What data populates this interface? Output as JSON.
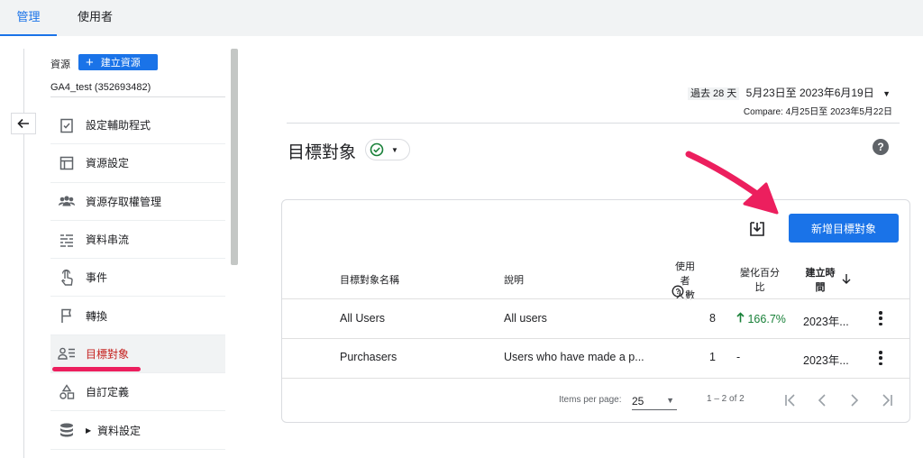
{
  "top_tabs": [
    {
      "label": "管理",
      "active": true
    },
    {
      "label": "使用者",
      "active": false
    }
  ],
  "sidebar": {
    "property_label": "資源",
    "create_button": "建立資源",
    "property_name": "GA4_test (352693482)",
    "items": [
      {
        "label": "設定輔助程式",
        "icon": "clipboard-check-icon"
      },
      {
        "label": "資源設定",
        "icon": "layout-icon"
      },
      {
        "label": "資源存取權管理",
        "icon": "people-icon"
      },
      {
        "label": "資料串流",
        "icon": "streams-icon"
      },
      {
        "label": "事件",
        "icon": "touch-icon"
      },
      {
        "label": "轉換",
        "icon": "flag-icon"
      },
      {
        "label": "目標對象",
        "icon": "audience-icon",
        "active": true
      },
      {
        "label": "自訂定義",
        "icon": "shapes-icon"
      },
      {
        "label": "資料設定",
        "icon": "database-icon",
        "expandable": true
      }
    ]
  },
  "date_range": {
    "period": "過去 28 天",
    "dates": "5月23日至 2023年6月19日",
    "compare": "Compare: 4月25日至 2023年5月22日"
  },
  "page": {
    "title": "目標對象",
    "new_button": "新增目標對象"
  },
  "table": {
    "headers": {
      "name": "目標對象名稱",
      "description": "說明",
      "users_line1": "使用者",
      "users_line2": "人數",
      "change_line1": "變化百分",
      "change_line2": "比",
      "created_line1": "建立時",
      "created_line2": "間"
    },
    "rows": [
      {
        "name": "All Users",
        "description": "All users",
        "users": "8",
        "change": "166.7%",
        "change_up": true,
        "created": "2023年..."
      },
      {
        "name": "Purchasers",
        "description": "Users who have made a p...",
        "users": "1",
        "change": "-",
        "change_up": false,
        "created": "2023年..."
      }
    ]
  },
  "pagination": {
    "items_per_page_label": "Items per page:",
    "items_per_page": "25",
    "range": "1 – 2 of 2"
  },
  "colors": {
    "accent": "#1a73e8",
    "active_nav_text": "#c5221f",
    "annotation_pink": "#ec1f5e",
    "positive": "#188038"
  }
}
